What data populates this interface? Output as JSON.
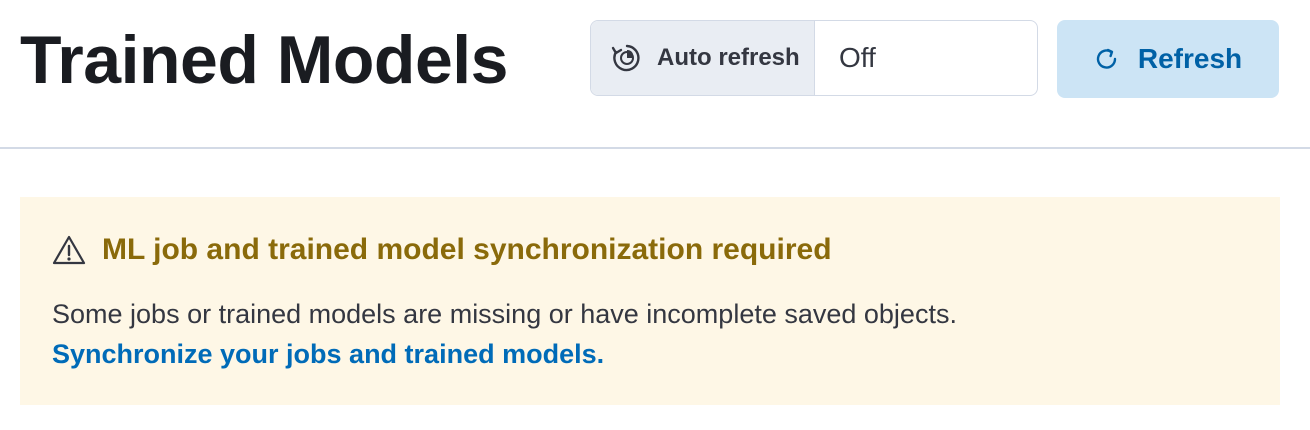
{
  "header": {
    "title": "Trained Models"
  },
  "auto_refresh": {
    "label": "Auto refresh",
    "value": "Off",
    "icon": "clock-refresh-icon"
  },
  "refresh_button": {
    "label": "Refresh",
    "icon": "refresh-icon"
  },
  "callout": {
    "icon": "warning-icon",
    "title": "ML job and trained model synchronization required",
    "text": "Some jobs or trained models are missing or have incomplete saved objects.",
    "link": "Synchronize your jobs and trained models."
  },
  "colors": {
    "title_text": "#1a1c21",
    "primary_button_bg": "#cce4f5",
    "primary_button_text": "#0061a6",
    "callout_bg": "#fef7e6",
    "callout_title": "#8a6a0a",
    "link": "#006bb8",
    "divider": "#d3dae6"
  }
}
